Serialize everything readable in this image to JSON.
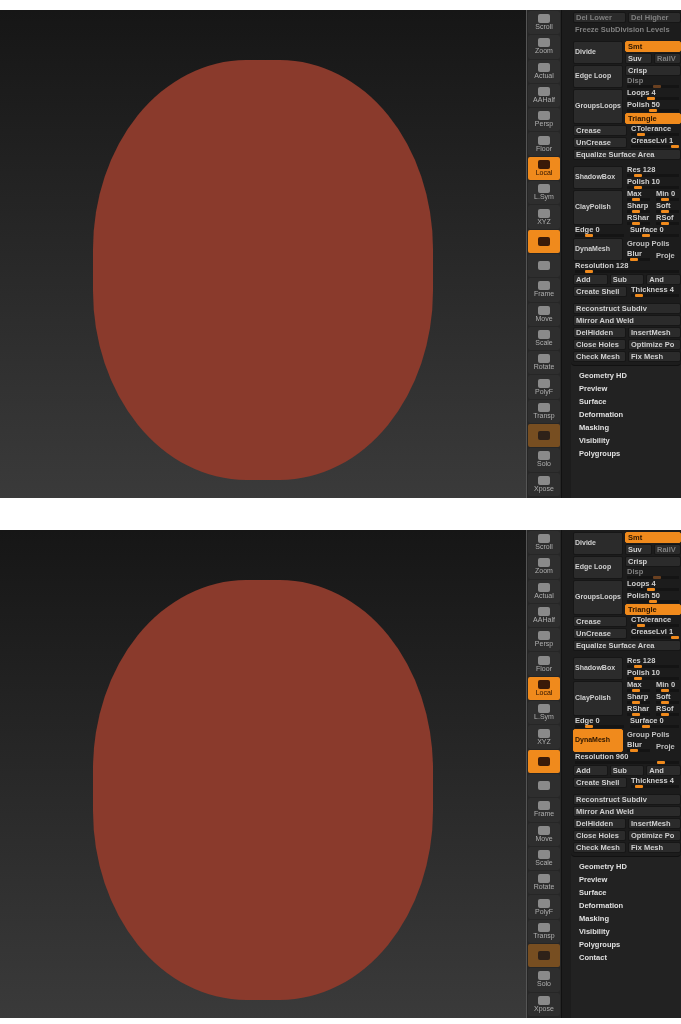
{
  "panels": [
    {
      "shelf": [
        {
          "label": "Scroll",
          "active": false,
          "disabled": false
        },
        {
          "label": "Zoom",
          "active": false,
          "disabled": false
        },
        {
          "label": "Actual",
          "active": false,
          "disabled": false
        },
        {
          "label": "AAHalf",
          "active": false,
          "disabled": false
        },
        {
          "label": "Persp",
          "active": false,
          "disabled": false
        },
        {
          "label": "Floor",
          "active": false,
          "disabled": false
        },
        {
          "label": "Local",
          "active": true,
          "disabled": false
        },
        {
          "label": "L.Sym",
          "active": false,
          "disabled": false
        },
        {
          "label": "XYZ",
          "active": false,
          "disabled": false
        },
        {
          "active": true,
          "disabled": false
        },
        {
          "active": false,
          "disabled": false
        },
        {
          "label": "Frame",
          "active": false,
          "disabled": false
        },
        {
          "label": "Move",
          "active": false,
          "disabled": false
        },
        {
          "label": "Scale",
          "active": false,
          "disabled": false
        },
        {
          "label": "Rotate",
          "active": false,
          "disabled": false
        },
        {
          "label": "PolyF",
          "active": false,
          "disabled": false
        },
        {
          "label": "Transp",
          "active": false,
          "disabled": false
        },
        {
          "active": true,
          "disabled": true
        },
        {
          "label": "Solo",
          "active": false,
          "disabled": false
        },
        {
          "label": "Xpose",
          "active": false,
          "disabled": false
        }
      ],
      "groups": [
        [
          {
            "kind": "cells",
            "cells": [
              {
                "kind": "button",
                "label": "Del Lower",
                "on": false,
                "disabled": true
              },
              {
                "kind": "button",
                "label": "Del Higher",
                "on": false,
                "disabled": true
              }
            ]
          },
          {
            "kind": "cells",
            "cells": [
              {
                "kind": "text",
                "label": "Freeze SubDivision Levels",
                "disabled": true
              }
            ]
          }
        ],
        [
          {
            "kind": "block",
            "button": {
              "label": "Divide",
              "on": false
            },
            "lines": [
              [
                {
                  "kind": "button",
                  "label": "Smt",
                  "on": true,
                  "disabled": false
                }
              ],
              [
                {
                  "kind": "button",
                  "label": "Suv",
                  "on": false,
                  "disabled": false
                },
                {
                  "kind": "button",
                  "label": "RailV",
                  "on": false,
                  "disabled": true
                }
              ]
            ]
          },
          {
            "kind": "block",
            "button": {
              "label": "Edge Loop",
              "on": false
            },
            "lines": [
              [
                {
                  "kind": "button",
                  "label": "Crisp",
                  "on": false,
                  "disabled": false
                }
              ],
              [
                {
                  "kind": "slider",
                  "label": "Disp",
                  "level": 0.6,
                  "disabled": true
                }
              ]
            ]
          },
          {
            "kind": "block",
            "button": {
              "label": "GroupsLoops",
              "on": false
            },
            "lines": [
              [
                {
                  "kind": "slider",
                  "label": "Loops 4",
                  "level": 0.45,
                  "disabled": false
                }
              ],
              [
                {
                  "kind": "slider",
                  "label": "Polish 50",
                  "level": 0.5,
                  "disabled": false
                }
              ],
              [
                {
                  "kind": "button",
                  "label": "Triangle",
                  "on": true,
                  "disabled": false
                }
              ]
            ]
          },
          {
            "kind": "cells",
            "cells": [
              {
                "kind": "button",
                "label": "Crease",
                "on": false,
                "disabled": false
              },
              {
                "kind": "slider",
                "label": "CTolerance",
                "level": 0.15,
                "disabled": false
              }
            ]
          },
          {
            "kind": "cells",
            "cells": [
              {
                "kind": "button",
                "label": "UnCrease",
                "on": false,
                "disabled": false
              },
              {
                "kind": "slider",
                "label": "CreaseLvl 1",
                "level": 1,
                "disabled": false
              }
            ]
          },
          {
            "kind": "cells",
            "cells": [
              {
                "kind": "button",
                "label": "Equalize Surface Area",
                "on": false,
                "disabled": false
              }
            ]
          }
        ],
        [
          {
            "kind": "block",
            "button": {
              "label": "ShadowBox",
              "on": false
            },
            "lines": [
              [
                {
                  "kind": "slider",
                  "label": "Res 128",
                  "level": 0.15,
                  "disabled": false
                }
              ],
              [
                {
                  "kind": "slider",
                  "label": "Polish 10",
                  "level": 0.15,
                  "disabled": false
                }
              ]
            ]
          },
          {
            "kind": "block",
            "button": {
              "label": "ClayPolish",
              "on": false
            },
            "lines": [
              [
                {
                  "kind": "slider",
                  "label": "Max",
                  "level": 0.3,
                  "disabled": false
                },
                {
                  "kind": "slider",
                  "label": "Min 0",
                  "level": 0.3,
                  "disabled": false
                }
              ],
              [
                {
                  "kind": "slider",
                  "label": "Sharp",
                  "level": 0.3,
                  "disabled": false
                },
                {
                  "kind": "slider",
                  "label": "Soft",
                  "level": 0.3,
                  "disabled": false
                }
              ],
              [
                {
                  "kind": "slider",
                  "label": "RShar",
                  "level": 0.3,
                  "disabled": false
                },
                {
                  "kind": "slider",
                  "label": "RSof",
                  "level": 0.3,
                  "disabled": false
                }
              ]
            ]
          },
          {
            "kind": "cells",
            "cells": [
              {
                "kind": "slider",
                "label": "Edge 0",
                "level": 0.25,
                "disabled": false
              },
              {
                "kind": "slider",
                "label": "Surface 0",
                "level": 0.3,
                "disabled": false
              }
            ]
          },
          {
            "kind": "block",
            "button": {
              "label": "DynaMesh",
              "on": false
            },
            "lines": [
              [
                {
                  "kind": "text",
                  "label": "Group Polis",
                  "disabled": false
                }
              ],
              [
                {
                  "kind": "slider",
                  "label": "Blur",
                  "level": 0.2,
                  "disabled": false
                },
                {
                  "kind": "text",
                  "label": "Proje",
                  "disabled": false
                }
              ]
            ]
          },
          {
            "kind": "cells",
            "cells": [
              {
                "kind": "slider",
                "label": "Resolution 128",
                "level": 0.1,
                "disabled": false
              }
            ]
          },
          {
            "kind": "cells",
            "cells": [
              {
                "kind": "button",
                "label": "Add",
                "on": false,
                "disabled": false
              },
              {
                "kind": "button",
                "label": "Sub",
                "on": false,
                "disabled": false
              },
              {
                "kind": "button",
                "label": "And",
                "on": false,
                "disabled": false
              }
            ]
          },
          {
            "kind": "cells",
            "cells": [
              {
                "kind": "button",
                "label": "Create Shell",
                "on": false,
                "disabled": false
              },
              {
                "kind": "slider",
                "label": "Thickness 4",
                "level": 0.1,
                "disabled": false
              }
            ]
          }
        ],
        [
          {
            "kind": "cells",
            "cells": [
              {
                "kind": "button",
                "label": "Reconstruct Subdiv",
                "on": false,
                "disabled": false
              }
            ]
          },
          {
            "kind": "cells",
            "cells": [
              {
                "kind": "button",
                "label": "Mirror And Weld",
                "on": false,
                "disabled": false
              }
            ]
          },
          {
            "kind": "cells",
            "cells": [
              {
                "kind": "button",
                "label": "DelHidden",
                "on": false,
                "disabled": false
              },
              {
                "kind": "button",
                "label": "InsertMesh",
                "on": false,
                "disabled": false
              }
            ]
          },
          {
            "kind": "cells",
            "cells": [
              {
                "kind": "button",
                "label": "Close Holes",
                "on": false,
                "disabled": false
              },
              {
                "kind": "button",
                "label": "Optimize Po",
                "on": false,
                "disabled": false
              }
            ]
          },
          {
            "kind": "cells",
            "cells": [
              {
                "kind": "button",
                "label": "Check Mesh",
                "on": false,
                "disabled": false
              },
              {
                "kind": "button",
                "label": "Fix Mesh",
                "on": false,
                "disabled": false
              }
            ]
          }
        ]
      ],
      "subpalettes": [
        "Geometry HD",
        "Preview",
        "Surface",
        "Deformation",
        "Masking",
        "Visibility",
        "Polygroups"
      ]
    },
    {
      "shelf": [
        {
          "label": "Scroll",
          "active": false,
          "disabled": false
        },
        {
          "label": "Zoom",
          "active": false,
          "disabled": false
        },
        {
          "label": "Actual",
          "active": false,
          "disabled": false
        },
        {
          "label": "AAHalf",
          "active": false,
          "disabled": false
        },
        {
          "label": "Persp",
          "active": false,
          "disabled": false
        },
        {
          "label": "Floor",
          "active": false,
          "disabled": false
        },
        {
          "label": "Local",
          "active": true,
          "disabled": false
        },
        {
          "label": "L.Sym",
          "active": false,
          "disabled": false
        },
        {
          "label": "XYZ",
          "active": false,
          "disabled": false
        },
        {
          "active": true,
          "disabled": false
        },
        {
          "active": false,
          "disabled": false
        },
        {
          "label": "Frame",
          "active": false,
          "disabled": false
        },
        {
          "label": "Move",
          "active": false,
          "disabled": false
        },
        {
          "label": "Scale",
          "active": false,
          "disabled": false
        },
        {
          "label": "Rotate",
          "active": false,
          "disabled": false
        },
        {
          "label": "PolyF",
          "active": false,
          "disabled": false
        },
        {
          "label": "Transp",
          "active": false,
          "disabled": false
        },
        {
          "active": true,
          "disabled": true
        },
        {
          "label": "Solo",
          "active": false,
          "disabled": false
        },
        {
          "label": "Xpose",
          "active": false,
          "disabled": false
        }
      ],
      "groups": [
        [
          {
            "kind": "block",
            "button": {
              "label": "Divide",
              "on": false
            },
            "lines": [
              [
                {
                  "kind": "button",
                  "label": "Smt",
                  "on": true,
                  "disabled": false
                }
              ],
              [
                {
                  "kind": "button",
                  "label": "Suv",
                  "on": false,
                  "disabled": false
                },
                {
                  "kind": "button",
                  "label": "RailV",
                  "on": false,
                  "disabled": true
                }
              ]
            ]
          },
          {
            "kind": "block",
            "button": {
              "label": "Edge Loop",
              "on": false
            },
            "lines": [
              [
                {
                  "kind": "button",
                  "label": "Crisp",
                  "on": false,
                  "disabled": false
                }
              ],
              [
                {
                  "kind": "slider",
                  "label": "Disp",
                  "level": 0.6,
                  "disabled": true
                }
              ]
            ]
          },
          {
            "kind": "block",
            "button": {
              "label": "GroupsLoops",
              "on": false
            },
            "lines": [
              [
                {
                  "kind": "slider",
                  "label": "Loops 4",
                  "level": 0.45,
                  "disabled": false
                }
              ],
              [
                {
                  "kind": "slider",
                  "label": "Polish 50",
                  "level": 0.5,
                  "disabled": false
                }
              ],
              [
                {
                  "kind": "button",
                  "label": "Triangle",
                  "on": true,
                  "disabled": false
                }
              ]
            ]
          },
          {
            "kind": "cells",
            "cells": [
              {
                "kind": "button",
                "label": "Crease",
                "on": false,
                "disabled": false
              },
              {
                "kind": "slider",
                "label": "CTolerance",
                "level": 0.15,
                "disabled": false
              }
            ]
          },
          {
            "kind": "cells",
            "cells": [
              {
                "kind": "button",
                "label": "UnCrease",
                "on": false,
                "disabled": false
              },
              {
                "kind": "slider",
                "label": "CreaseLvl 1",
                "level": 1,
                "disabled": false
              }
            ]
          },
          {
            "kind": "cells",
            "cells": [
              {
                "kind": "button",
                "label": "Equalize Surface Area",
                "on": false,
                "disabled": false
              }
            ]
          }
        ],
        [
          {
            "kind": "block",
            "button": {
              "label": "ShadowBox",
              "on": false
            },
            "lines": [
              [
                {
                  "kind": "slider",
                  "label": "Res 128",
                  "level": 0.15,
                  "disabled": false
                }
              ],
              [
                {
                  "kind": "slider",
                  "label": "Polish 10",
                  "level": 0.15,
                  "disabled": false
                }
              ]
            ]
          },
          {
            "kind": "block",
            "button": {
              "label": "ClayPolish",
              "on": false
            },
            "lines": [
              [
                {
                  "kind": "slider",
                  "label": "Max",
                  "level": 0.3,
                  "disabled": false
                },
                {
                  "kind": "slider",
                  "label": "Min 0",
                  "level": 0.3,
                  "disabled": false
                }
              ],
              [
                {
                  "kind": "slider",
                  "label": "Sharp",
                  "level": 0.3,
                  "disabled": false
                },
                {
                  "kind": "slider",
                  "label": "Soft",
                  "level": 0.3,
                  "disabled": false
                }
              ],
              [
                {
                  "kind": "slider",
                  "label": "RShar",
                  "level": 0.3,
                  "disabled": false
                },
                {
                  "kind": "slider",
                  "label": "RSof",
                  "level": 0.3,
                  "disabled": false
                }
              ]
            ]
          },
          {
            "kind": "cells",
            "cells": [
              {
                "kind": "slider",
                "label": "Edge 0",
                "level": 0.25,
                "disabled": false
              },
              {
                "kind": "slider",
                "label": "Surface 0",
                "level": 0.3,
                "disabled": false
              }
            ]
          },
          {
            "kind": "block",
            "button": {
              "label": "DynaMesh",
              "on": true
            },
            "lines": [
              [
                {
                  "kind": "text",
                  "label": "Group Polis",
                  "disabled": false
                }
              ],
              [
                {
                  "kind": "slider",
                  "label": "Blur",
                  "level": 0.2,
                  "disabled": false
                },
                {
                  "kind": "text",
                  "label": "Proje",
                  "disabled": false
                }
              ]
            ]
          },
          {
            "kind": "cells",
            "cells": [
              {
                "kind": "slider",
                "label": "Resolution 960",
                "level": 0.85,
                "disabled": false
              }
            ]
          },
          {
            "kind": "cells",
            "cells": [
              {
                "kind": "button",
                "label": "Add",
                "on": false,
                "disabled": false
              },
              {
                "kind": "button",
                "label": "Sub",
                "on": false,
                "disabled": false
              },
              {
                "kind": "button",
                "label": "And",
                "on": false,
                "disabled": false
              }
            ]
          },
          {
            "kind": "cells",
            "cells": [
              {
                "kind": "button",
                "label": "Create Shell",
                "on": false,
                "disabled": false
              },
              {
                "kind": "slider",
                "label": "Thickness 4",
                "level": 0.1,
                "disabled": false
              }
            ]
          }
        ],
        [
          {
            "kind": "cells",
            "cells": [
              {
                "kind": "button",
                "label": "Reconstruct Subdiv",
                "on": false,
                "disabled": false
              }
            ]
          },
          {
            "kind": "cells",
            "cells": [
              {
                "kind": "button",
                "label": "Mirror And Weld",
                "on": false,
                "disabled": false
              }
            ]
          },
          {
            "kind": "cells",
            "cells": [
              {
                "kind": "button",
                "label": "DelHidden",
                "on": false,
                "disabled": false
              },
              {
                "kind": "button",
                "label": "InsertMesh",
                "on": false,
                "disabled": false
              }
            ]
          },
          {
            "kind": "cells",
            "cells": [
              {
                "kind": "button",
                "label": "Close Holes",
                "on": false,
                "disabled": false
              },
              {
                "kind": "button",
                "label": "Optimize Po",
                "on": false,
                "disabled": false
              }
            ]
          },
          {
            "kind": "cells",
            "cells": [
              {
                "kind": "button",
                "label": "Check Mesh",
                "on": false,
                "disabled": false
              },
              {
                "kind": "button",
                "label": "Fix Mesh",
                "on": false,
                "disabled": false
              }
            ]
          }
        ]
      ],
      "subpalettes": [
        "Geometry HD",
        "Preview",
        "Surface",
        "Deformation",
        "Masking",
        "Visibility",
        "Polygroups",
        "Contact"
      ]
    }
  ]
}
